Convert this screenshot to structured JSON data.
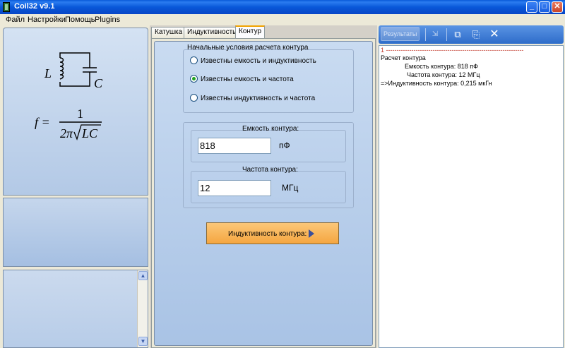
{
  "window": {
    "title": "Coil32 v9.1",
    "buttons": {
      "minimize": "_",
      "maximize": "□",
      "close": "✕"
    }
  },
  "menu": [
    "Файл",
    "Настройки",
    "Помощь",
    "Plugins"
  ],
  "tabs": [
    "Катушка",
    "Индуктивность",
    "Контур"
  ],
  "active_tab_index": 2,
  "initial_conditions": {
    "title": "Начальные условия расчета контура",
    "options": [
      "Известны емкость и индуктивность",
      "Известны емкость и частота",
      "Известны индуктивность и частота"
    ],
    "selected_index": 1
  },
  "capacitance": {
    "label": "Емкость контура:",
    "value": "818",
    "unit": "пФ"
  },
  "frequency": {
    "label": "Частота контура:",
    "value": "12",
    "unit": "МГц"
  },
  "calculate_button": {
    "label": "Индуктивность контура:"
  },
  "toolbar": {
    "results_label": "Результаты"
  },
  "results": {
    "lines": [
      "1 -----------------------------------------------------------------",
      "Расчет контура",
      "Емкость контура: 818 пФ",
      "Частота контура: 12 МГц",
      "=>Индуктивность контура: 0,215 мкГн"
    ]
  },
  "formula": {
    "circuit_labels": {
      "inductor": "L",
      "capacitor": "C"
    },
    "lhs": "f =",
    "numerator": "1",
    "denominator_prefix": "2π",
    "denominator_radicand": "LC"
  },
  "icons": {
    "app": "app-icon",
    "scroll_up": "chevron-up-icon",
    "scroll_down": "chevron-down-icon",
    "play": "play-icon",
    "format": "format-icon",
    "copy": "copy-icon",
    "save": "save-icon",
    "clear": "close-icon"
  },
  "colors": {
    "accent_orange": "#f5a640",
    "panel_blue": "#a9c3e5",
    "radio_checked": "#21a121",
    "result_separator": "#c0392b"
  }
}
